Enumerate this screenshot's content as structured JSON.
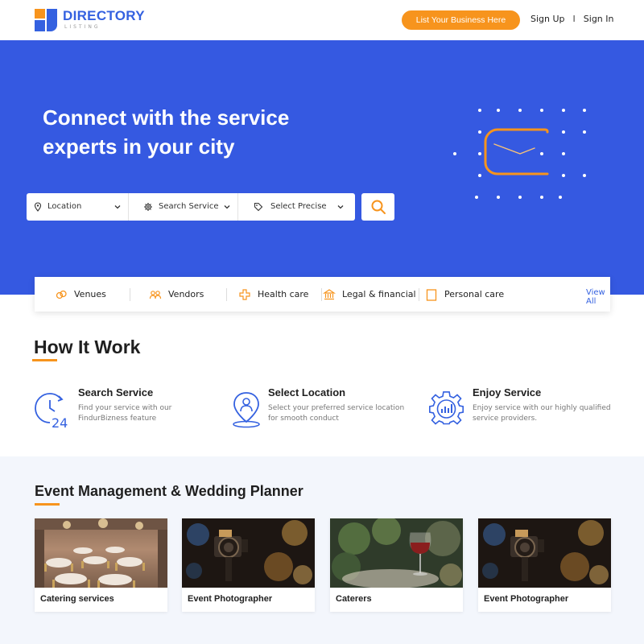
{
  "header": {
    "logo_title": "DIRECTORY",
    "logo_subtitle": "LISTING",
    "list_business": "List Your Business Here",
    "sign_up": "Sign Up",
    "separator": "I",
    "sign_in": "Sign In"
  },
  "hero": {
    "title": "Connect with the service experts in your city",
    "search": {
      "location": "Location",
      "service": "Search Service",
      "precise": "Select Precise"
    }
  },
  "categories": {
    "items": [
      {
        "label": "Venues",
        "icon": "rings-icon"
      },
      {
        "label": "Vendors",
        "icon": "people-icon"
      },
      {
        "label": "Health care",
        "icon": "health-cross-icon"
      },
      {
        "label": "Legal & financial",
        "icon": "bank-icon"
      },
      {
        "label": "Personal care",
        "icon": "document-icon"
      }
    ],
    "view_all": "View All"
  },
  "how_it_work": {
    "title": "How It Work",
    "steps": [
      {
        "title": "Search Service",
        "desc": "Find your service with our FindurBizness feature",
        "icon": "clock-24-icon"
      },
      {
        "title": "Select Location",
        "desc": "Select your preferred service location for smooth conduct",
        "icon": "location-person-icon"
      },
      {
        "title": "Enjoy Service",
        "desc": "Enjoy service with our highly qualified service providers.",
        "icon": "gear-chart-icon"
      }
    ]
  },
  "event_section": {
    "title": "Event Management & Wedding Planner",
    "cards": [
      {
        "label": "Catering services"
      },
      {
        "label": "Event Photographer"
      },
      {
        "label": "Caterers"
      },
      {
        "label": "Event Photographer"
      }
    ]
  },
  "colors": {
    "primary_blue": "#3559e1",
    "accent_orange": "#f7941d"
  }
}
